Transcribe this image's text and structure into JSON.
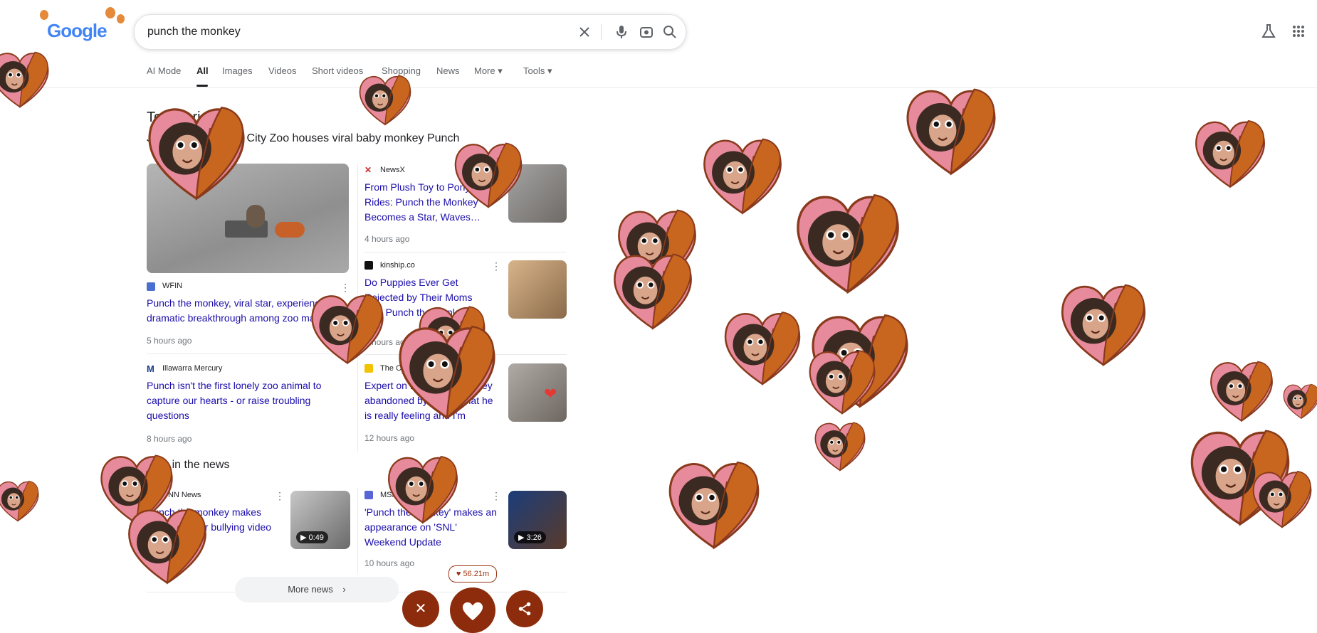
{
  "logo": {
    "text": "Google"
  },
  "search": {
    "query": "punch the monkey"
  },
  "nav": {
    "tabs": [
      "AI Mode",
      "All",
      "Images",
      "Videos",
      "Short videos",
      "Shopping",
      "News",
      "More",
      "Tools"
    ],
    "active": "All"
  },
  "top_stories": {
    "heading": "Top stories",
    "subheading": "Japanese Ichikawa City Zoo houses viral baby monkey Punch",
    "lead": {
      "source": "WFIN",
      "headline": "Punch the monkey, viral star, experiences dramatic breakthrough among zoo mates",
      "time": "5 hours ago"
    },
    "left_second": {
      "source": "Illawarra Mercury",
      "headline": "Punch isn't the first lonely zoo animal to capture our hearts - or raise troubling questions",
      "time": "8 hours ago"
    },
    "right": [
      {
        "source": "NewsX",
        "headline": "From Plush Toy to Pony Rides: Punch the Monkey Becomes a Star, Waves…",
        "time": "4 hours ago"
      },
      {
        "source": "kinship.co",
        "headline": "Do Puppies Ever Get Rejected by Their Moms Like Punch the Monkey?",
        "time": "6 hours ago"
      },
      {
        "source": "The Conversation",
        "headline": "Expert on Punch the monkey abandoned by mom: what he is really feeling and I'm actua…",
        "time": "12 hours ago"
      }
    ]
  },
  "also_news": {
    "heading": "Also in the news",
    "items": [
      {
        "source": "CNN News",
        "headline": "Punch the monkey makes progress after bullying video",
        "time": "",
        "duration": "0:49"
      },
      {
        "source": "MSN",
        "headline": "'Punch the monkey' makes an appearance on 'SNL' Weekend Update",
        "time": "10 hours ago",
        "duration": "3:26"
      }
    ]
  },
  "more_news": {
    "label": "More news"
  },
  "overlay": {
    "like_count": "56.21m"
  },
  "colors": {
    "link": "#1a0dab",
    "overlay_button": "#8c2c0c",
    "heart_pink": "#e78a9b",
    "heart_orange": "#c8661f",
    "monkey_fur": "#3b2a22"
  },
  "icons": [
    "clear-icon",
    "microphone-icon",
    "lens-icon",
    "search-icon",
    "labs-icon",
    "apps-icon",
    "close-icon",
    "heart-icon",
    "share-icon"
  ]
}
